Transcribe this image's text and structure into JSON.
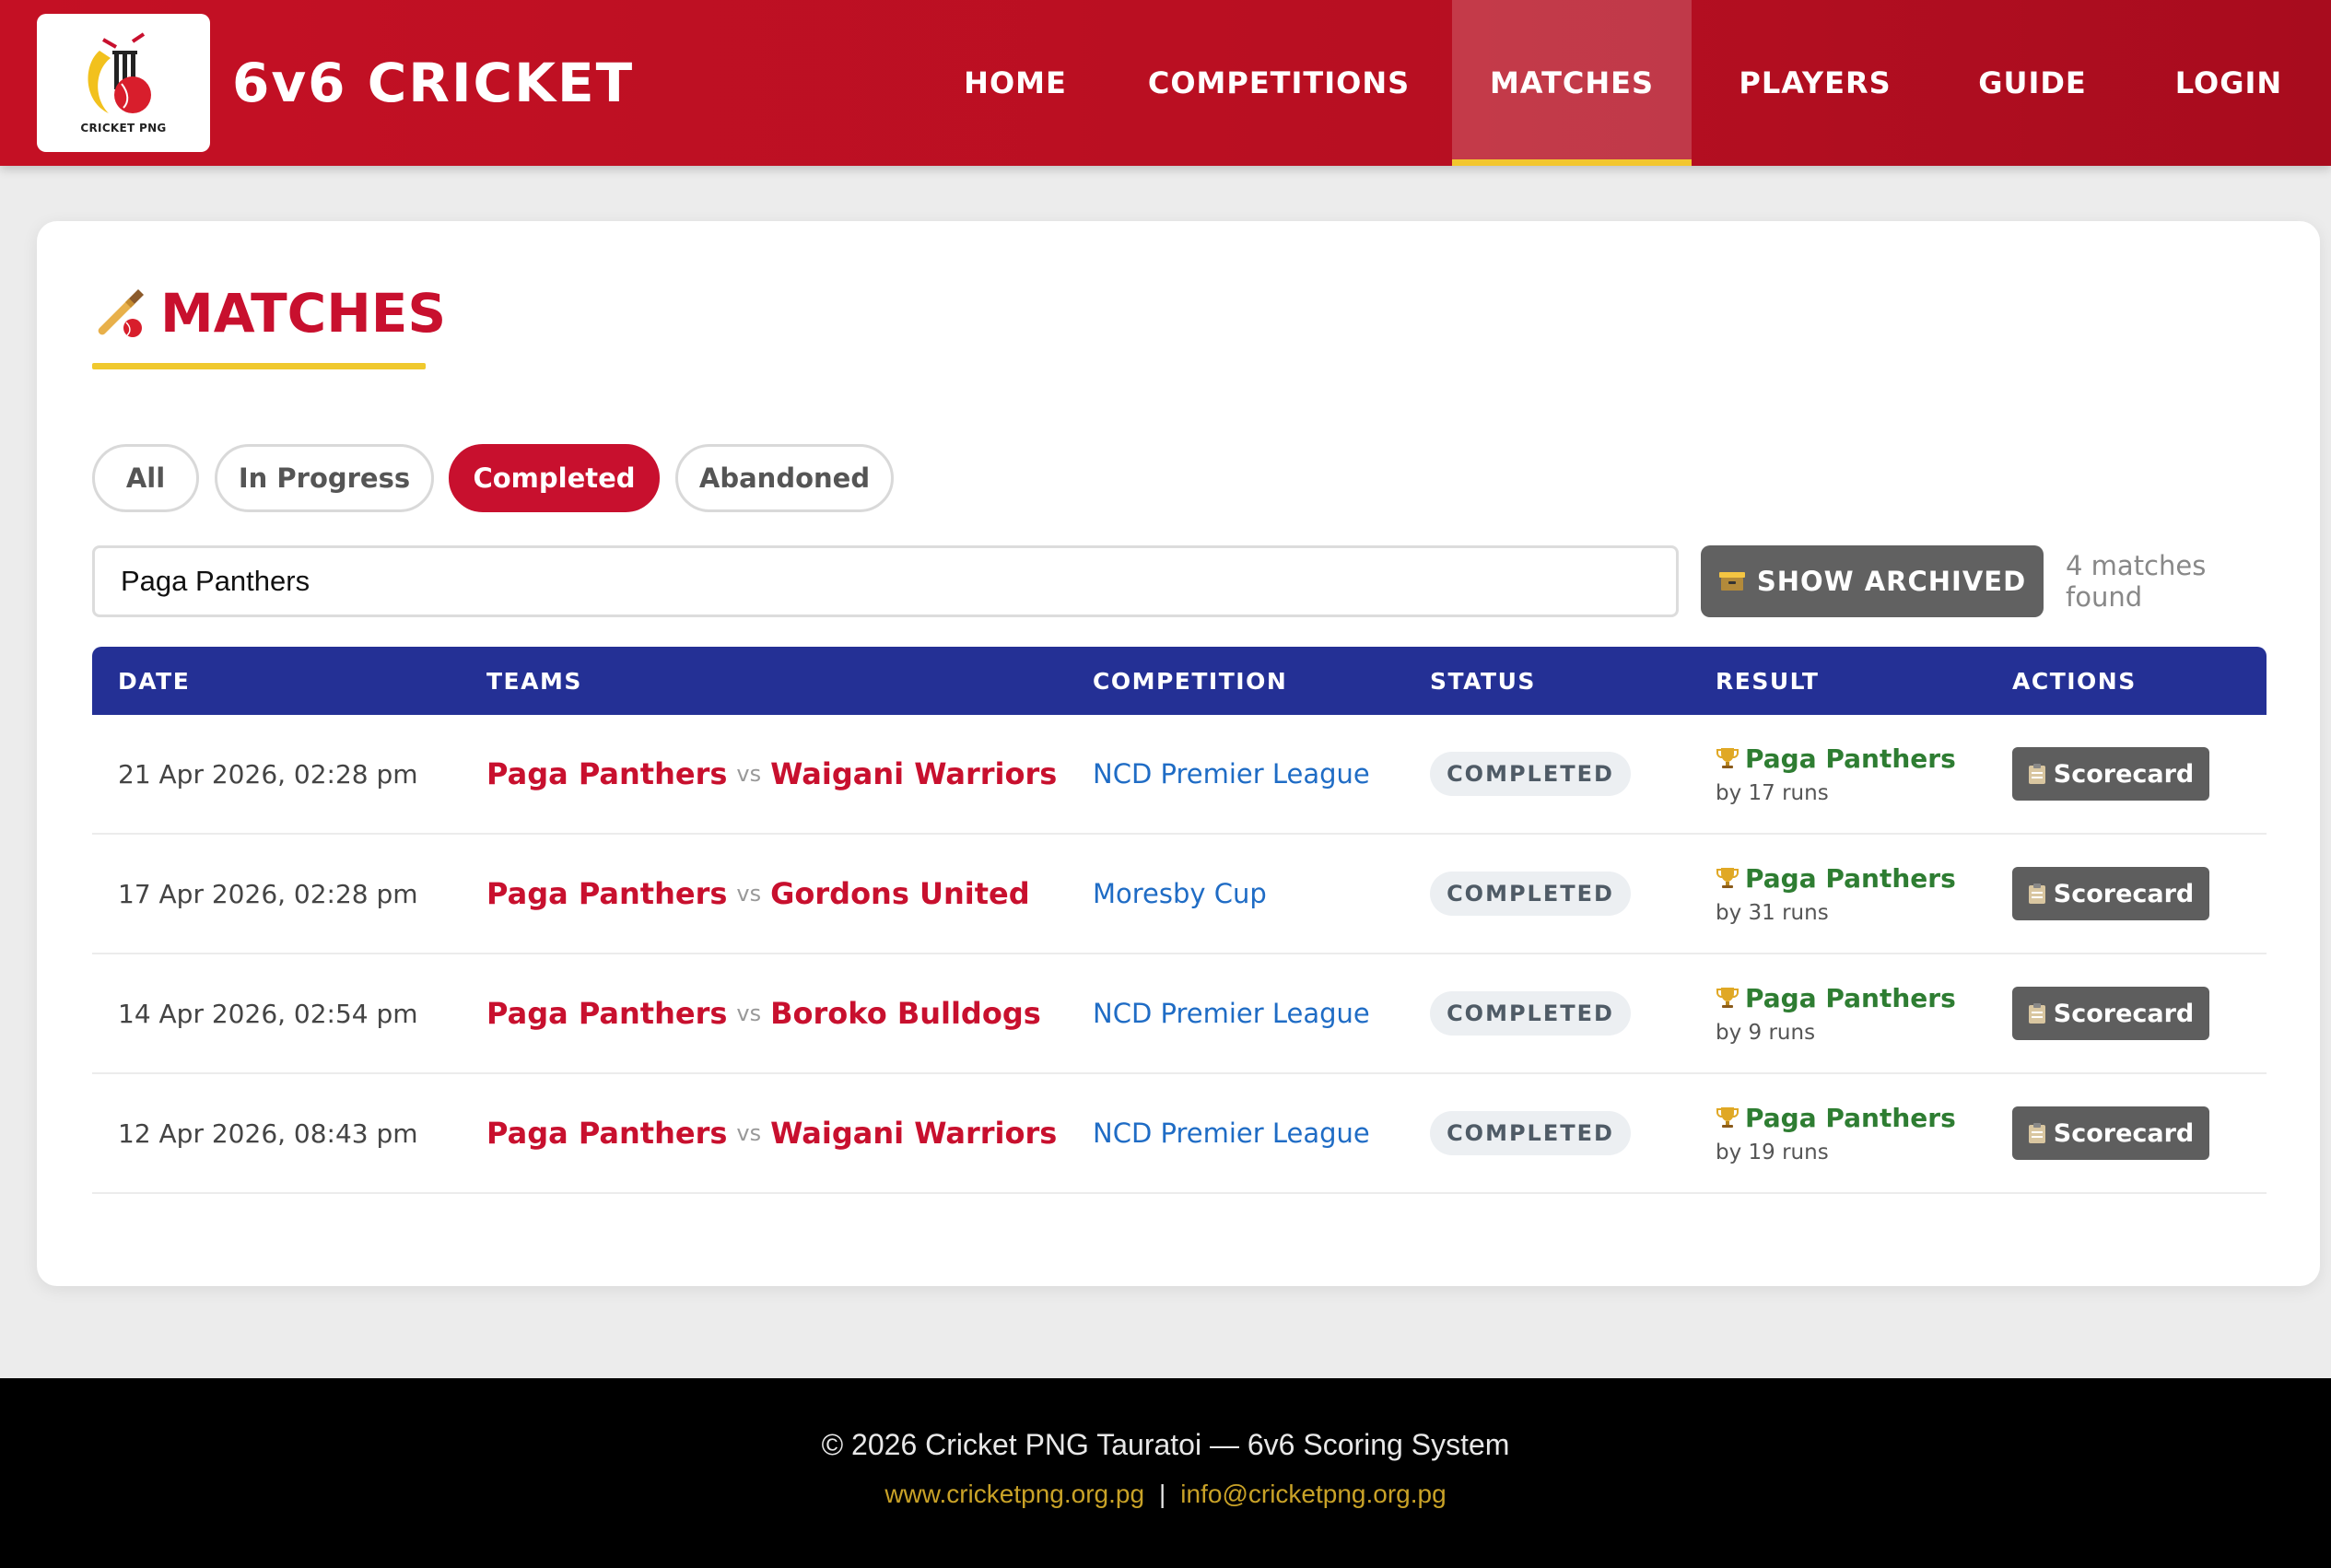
{
  "header": {
    "logo_text": "CRICKET PNG",
    "brand": "6v6 CRICKET",
    "nav": [
      {
        "label": "HOME"
      },
      {
        "label": "COMPETITIONS"
      },
      {
        "label": "MATCHES",
        "active": true
      },
      {
        "label": "PLAYERS"
      },
      {
        "label": "GUIDE"
      },
      {
        "label": "LOGIN"
      }
    ]
  },
  "page": {
    "title_icon": "cricket-bat-icon",
    "title": "MATCHES"
  },
  "filters": [
    {
      "label": "All"
    },
    {
      "label": "In Progress"
    },
    {
      "label": "Completed",
      "active": true
    },
    {
      "label": "Abandoned"
    }
  ],
  "search": {
    "value": "Paga Panthers"
  },
  "archived_button": {
    "icon": "archive-box-icon",
    "label": "SHOW ARCHIVED"
  },
  "matches_count": "4 matches found",
  "table": {
    "columns": [
      "DATE",
      "TEAMS",
      "COMPETITION",
      "STATUS",
      "RESULT",
      "ACTIONS"
    ],
    "vs_label": "vs",
    "rows": [
      {
        "date": "21 Apr 2026, 02:28 pm",
        "team_a": "Paga Panthers",
        "team_b": "Waigani Warriors",
        "competition": "NCD Premier League",
        "status": "COMPLETED",
        "winner": "Paga Panthers",
        "margin": "by 17 runs",
        "action": "Scorecard"
      },
      {
        "date": "17 Apr 2026, 02:28 pm",
        "team_a": "Paga Panthers",
        "team_b": "Gordons United",
        "competition": "Moresby Cup",
        "status": "COMPLETED",
        "winner": "Paga Panthers",
        "margin": "by 31 runs",
        "action": "Scorecard"
      },
      {
        "date": "14 Apr 2026, 02:54 pm",
        "team_a": "Paga Panthers",
        "team_b": "Boroko Bulldogs",
        "competition": "NCD Premier League",
        "status": "COMPLETED",
        "winner": "Paga Panthers",
        "margin": "by 9 runs",
        "action": "Scorecard"
      },
      {
        "date": "12 Apr 2026, 08:43 pm",
        "team_a": "Paga Panthers",
        "team_b": "Waigani Warriors",
        "competition": "NCD Premier League",
        "status": "COMPLETED",
        "winner": "Paga Panthers",
        "margin": "by 19 runs",
        "action": "Scorecard"
      }
    ]
  },
  "footer": {
    "copyright": "© 2026 Cricket PNG Tauratoi — 6v6 Scoring System",
    "website": "www.cricketpng.org.pg",
    "separator": "|",
    "email": "info@cricketpng.org.pg"
  },
  "colors": {
    "brand_red": "#c8102e",
    "accent_yellow": "#f0c92e",
    "table_header_navy": "#243095",
    "win_green": "#2e7d32",
    "link_blue": "#1f6cc5"
  }
}
